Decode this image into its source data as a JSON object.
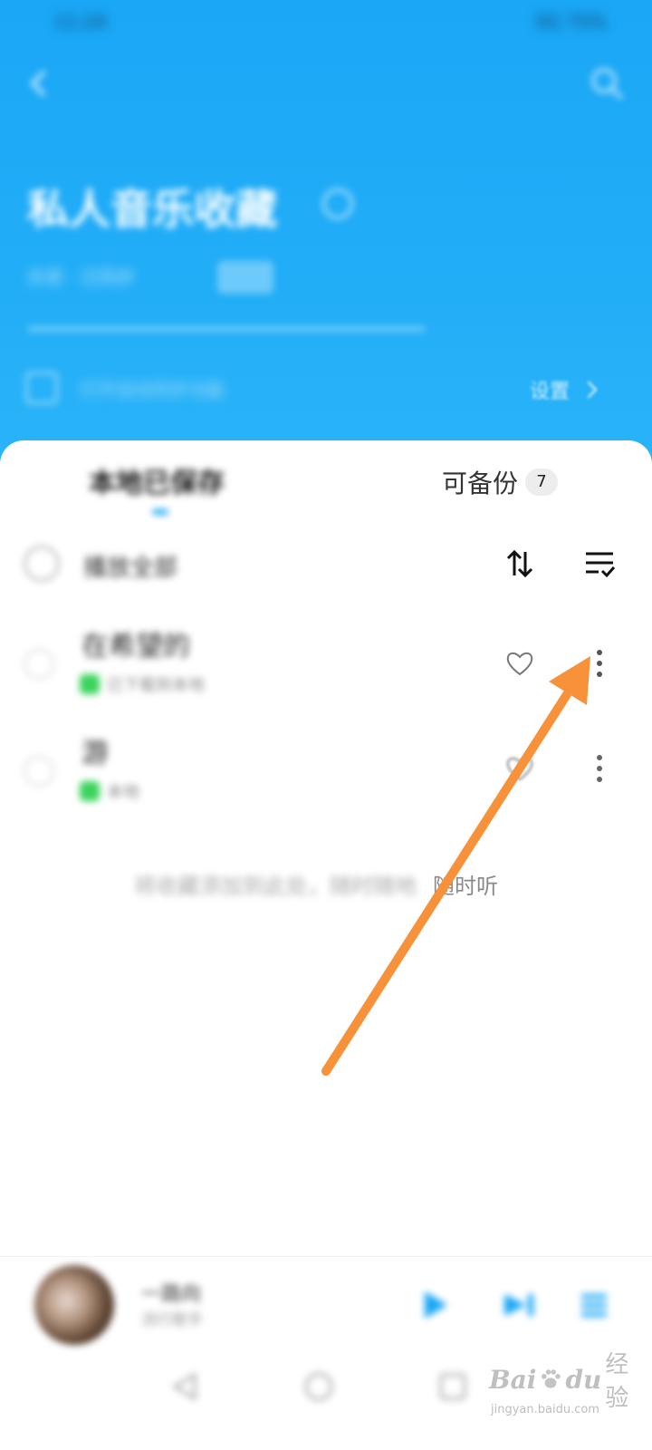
{
  "header": {
    "status_time": "11:24",
    "status_right": "5G 75%",
    "title": "私人音乐收藏",
    "meta": "共享 · 已同步",
    "notice": "打开自动同步功能",
    "settings_label": "设置"
  },
  "tabs": {
    "active_label": "本地已保存",
    "backup_label": "可备份",
    "backup_count": "7"
  },
  "toolbar": {
    "play_all_label": "播放全部"
  },
  "songs": [
    {
      "title": "在希望的",
      "subtitle": "已下载到本地"
    },
    {
      "title": "游",
      "subtitle": "本地"
    }
  ],
  "tip": {
    "text": "将收藏添加到此处，随时随地",
    "visible_suffix": "随时听"
  },
  "player": {
    "title": "一路向",
    "artist": "流行歌手"
  },
  "watermark": {
    "brand": "Bai",
    "brand_tail": "du",
    "brand_cn": "经验",
    "url": "jingyan.baidu.com"
  },
  "colors": {
    "header_blue": "#1aa7f6",
    "annotation_arrow": "#f7923a",
    "tag_green": "#3ad35c"
  }
}
